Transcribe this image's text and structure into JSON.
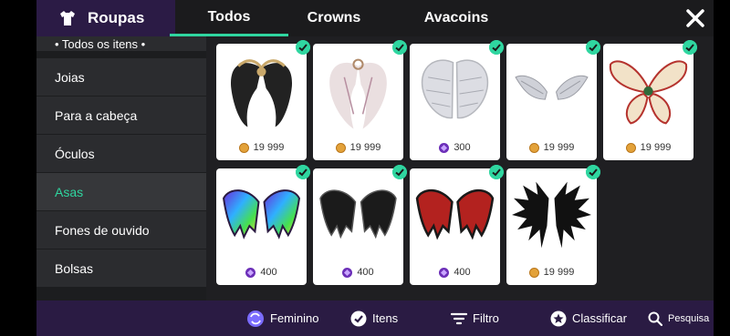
{
  "header": {
    "category_label": "Roupas",
    "tabs": [
      {
        "label": "Todos",
        "active": true
      },
      {
        "label": "Crowns",
        "active": false
      },
      {
        "label": "Avacoins",
        "active": false
      }
    ]
  },
  "sidebar": {
    "items": [
      {
        "label": "• Todos os itens •"
      },
      {
        "label": "Joias"
      },
      {
        "label": "Para a cabeça"
      },
      {
        "label": "Óculos"
      },
      {
        "label": "Asas",
        "selected": true
      },
      {
        "label": "Fones de ouvido"
      },
      {
        "label": "Bolsas"
      }
    ]
  },
  "items": [
    {
      "price": "19 999",
      "currency": "coin",
      "owned": true
    },
    {
      "price": "19 999",
      "currency": "coin",
      "owned": true
    },
    {
      "price": "300",
      "currency": "gem",
      "owned": true
    },
    {
      "price": "19 999",
      "currency": "coin",
      "owned": true
    },
    {
      "price": "19 999",
      "currency": "coin",
      "owned": true
    },
    {
      "price": "400",
      "currency": "gem",
      "owned": true
    },
    {
      "price": "400",
      "currency": "gem",
      "owned": true
    },
    {
      "price": "400",
      "currency": "gem",
      "owned": true
    },
    {
      "price": "19 999",
      "currency": "coin",
      "owned": true
    }
  ],
  "bottom_bar": {
    "feminino": "Feminino",
    "itens": "Itens",
    "filtro": "Filtro",
    "classificar": "Classificar",
    "pesquisa": "Pesquisa"
  },
  "colors": {
    "accent": "#2fd6a0",
    "purple_bar": "#2a1b43",
    "coin": "#e3a23a",
    "gem": "#6c2fb8"
  }
}
